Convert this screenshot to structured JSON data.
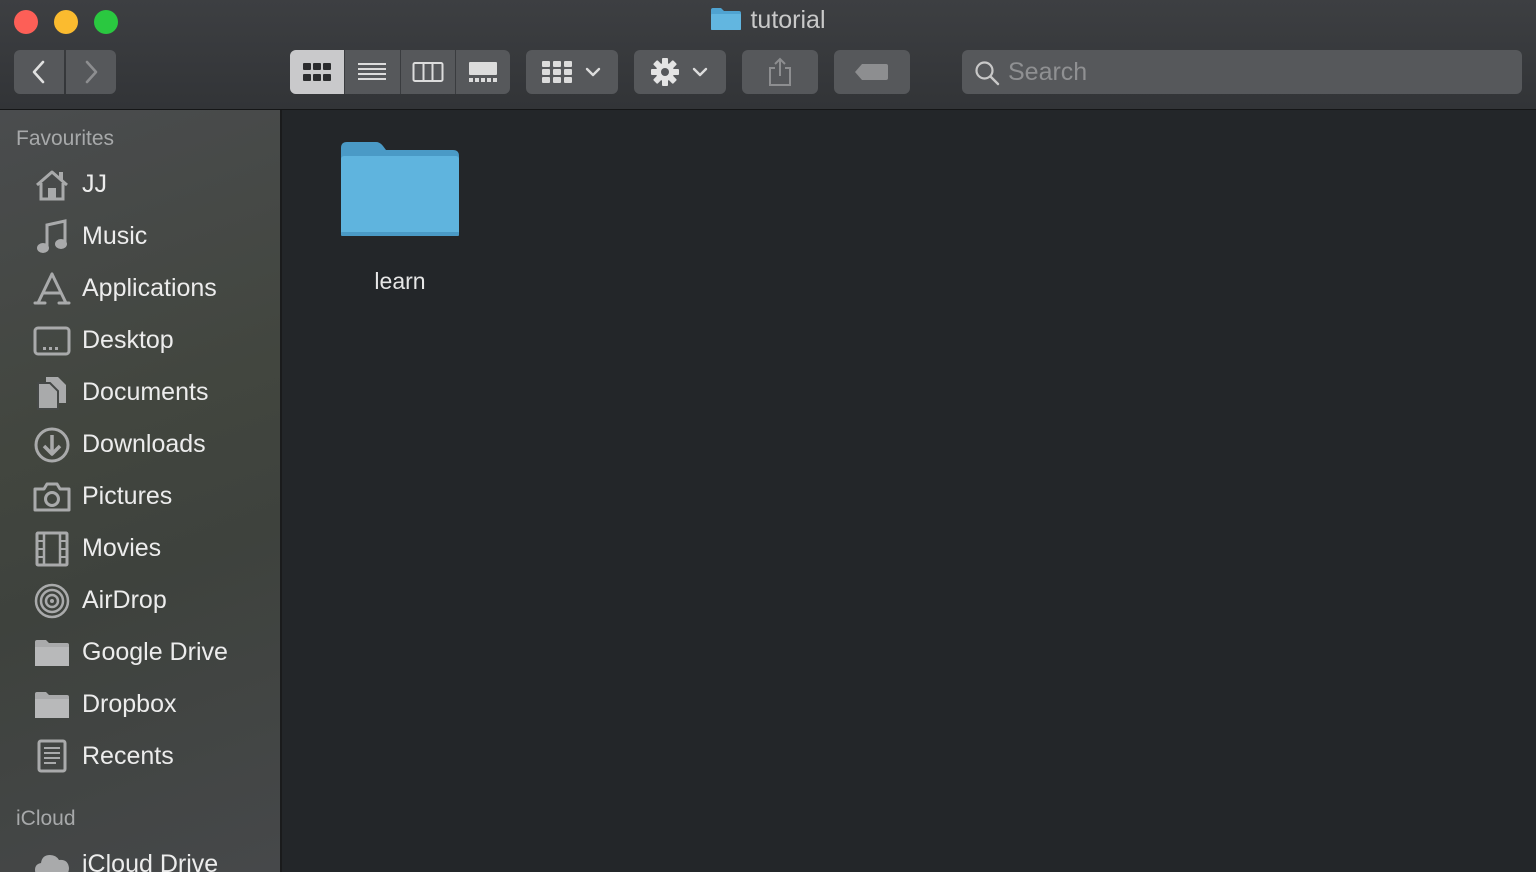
{
  "window": {
    "title": "tutorial"
  },
  "toolbar": {
    "back_icon": "chevron-left-icon",
    "forward_icon": "chevron-right-icon",
    "view_modes": [
      "icon-view",
      "list-view",
      "column-view",
      "gallery-view"
    ],
    "active_view": "icon-view",
    "group_icon": "group-by-icon",
    "action_icon": "gear-icon",
    "share_icon": "share-icon",
    "tag_icon": "tag-icon"
  },
  "search": {
    "placeholder": "Search",
    "value": ""
  },
  "sidebar": {
    "favourites_heading": "Favourites",
    "items": [
      {
        "label": "JJ",
        "icon": "home-icon"
      },
      {
        "label": "Music",
        "icon": "music-note-icon"
      },
      {
        "label": "Applications",
        "icon": "applications-icon"
      },
      {
        "label": "Desktop",
        "icon": "desktop-icon"
      },
      {
        "label": "Documents",
        "icon": "documents-icon"
      },
      {
        "label": "Downloads",
        "icon": "downloads-icon"
      },
      {
        "label": "Pictures",
        "icon": "camera-icon"
      },
      {
        "label": "Movies",
        "icon": "film-icon"
      },
      {
        "label": "AirDrop",
        "icon": "airdrop-icon"
      },
      {
        "label": "Google Drive",
        "icon": "folder-icon"
      },
      {
        "label": "Dropbox",
        "icon": "folder-icon"
      },
      {
        "label": "Recents",
        "icon": "recents-icon"
      }
    ],
    "icloud_heading": "iCloud",
    "icloud_items": [
      {
        "label": "iCloud Drive",
        "icon": "cloud-icon"
      }
    ]
  },
  "content": {
    "items": [
      {
        "name": "learn",
        "icon": "folder-icon"
      }
    ]
  },
  "colors": {
    "folder_blue": "#5fb4de",
    "close": "#fd5f57",
    "minimize": "#fbbb2f",
    "maximize": "#2ac840"
  }
}
